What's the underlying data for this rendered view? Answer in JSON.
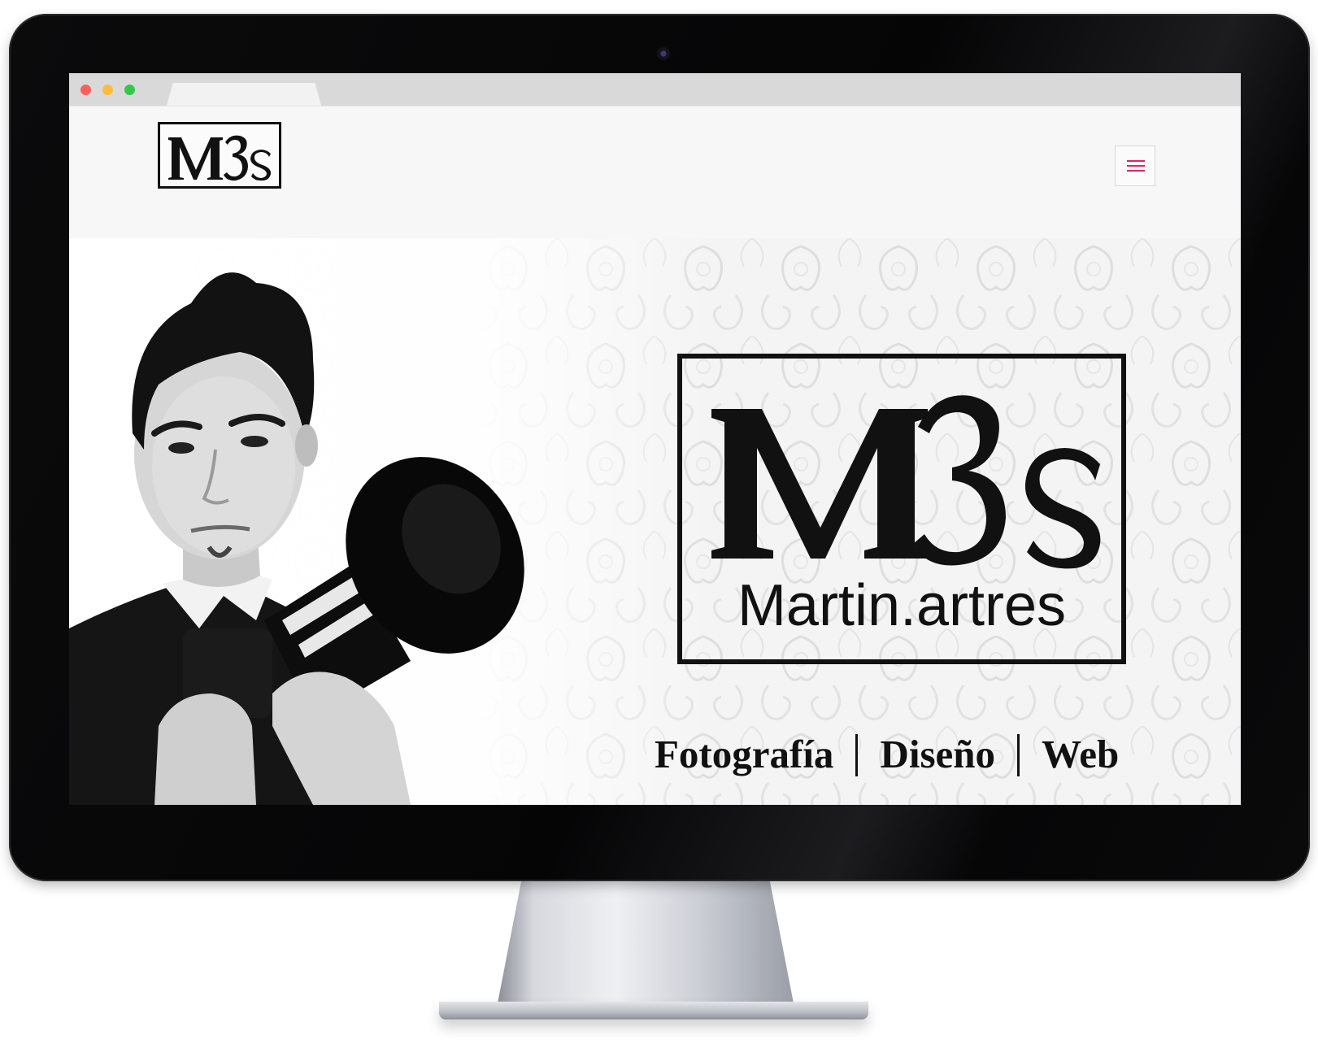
{
  "site": {
    "brand_name": "Martin.artres",
    "logo_monogram": "M3s"
  },
  "header": {
    "menu_icon": "hamburger-icon"
  },
  "hero": {
    "services": [
      "Fotografía",
      "Diseño",
      "Web"
    ],
    "photo": "man-with-camera-photo"
  },
  "colors": {
    "menu_accent": "#e0245e",
    "traffic_red": "#fc605c",
    "traffic_yellow": "#fdbc40",
    "traffic_green": "#34c84a"
  }
}
